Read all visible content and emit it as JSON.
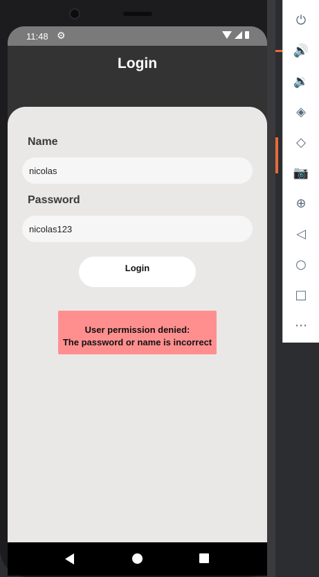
{
  "status_bar": {
    "time": "11:48",
    "gear_icon": "gear-icon",
    "icons": [
      "wifi-icon",
      "signal-icon",
      "battery-icon"
    ]
  },
  "app_bar": {
    "title": "Login"
  },
  "form": {
    "name_label": "Name",
    "name_value": "nicolas",
    "password_label": "Password",
    "password_value": "nicolas123",
    "login_button": "Login"
  },
  "error": {
    "line1": "User permission denied:",
    "line2": "The password or name is incorrect",
    "color": "#ff8f8f"
  },
  "nav_bar": {
    "icons": [
      "back-icon",
      "home-icon",
      "recents-icon"
    ]
  },
  "emulator_toolbar": {
    "icons": [
      "power-icon",
      "volume-up-icon",
      "volume-down-icon",
      "rotate-left-icon",
      "rotate-right-icon",
      "camera-icon",
      "zoom-icon",
      "back-icon",
      "home-icon",
      "overview-icon",
      "more-icon"
    ]
  }
}
